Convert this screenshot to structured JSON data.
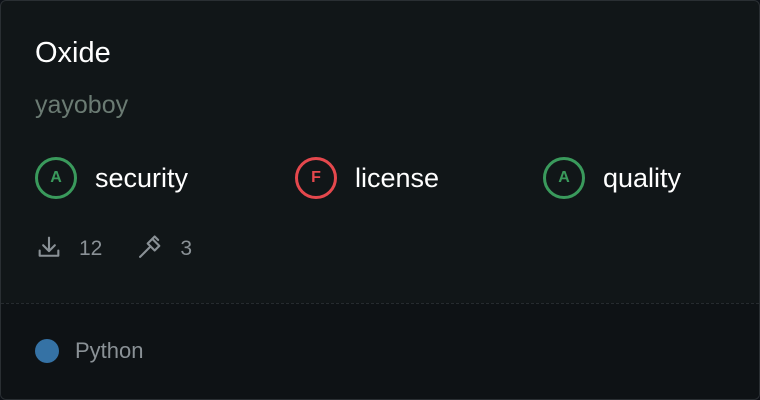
{
  "repo": {
    "name": "Oxide",
    "owner": "yayoboy"
  },
  "grades": [
    {
      "grade": "A",
      "label": "security",
      "color": "#3a9a5c"
    },
    {
      "grade": "F",
      "label": "license",
      "color": "#e5484d"
    },
    {
      "grade": "A",
      "label": "quality",
      "color": "#3a9a5c"
    }
  ],
  "stats": {
    "downloads": "12",
    "builds": "3"
  },
  "language": {
    "name": "Python",
    "color": "#3572A5"
  }
}
